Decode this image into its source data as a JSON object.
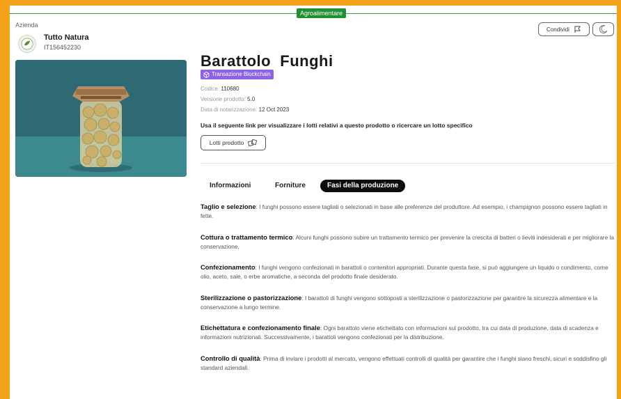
{
  "header": {
    "category_badge": "Agroalimentare",
    "share_label": "Condividi"
  },
  "company": {
    "caption": "Azienda",
    "name": "Tutto Natura",
    "vat": "IT156452230",
    "logo_icon": "leaf-logo"
  },
  "product": {
    "title": "Barattolo  Funghi",
    "blockchain_badge": "Transazione Blockchain",
    "code_label": "Codice:",
    "code_value": "110680",
    "version_label": "Versione prodotto:",
    "version_value": "5.0",
    "notarization_label": "Data di notarizzazione:",
    "notarization_value": "12 Oct 2023",
    "link_text": "Usa il seguente link per visualizzare i lotti relativi a questo prodotto o ricercare un lotto specifico",
    "lots_button": "Lotti prodotto"
  },
  "tabs": [
    {
      "label": "Informazioni",
      "active": false
    },
    {
      "label": "Forniture",
      "active": false
    },
    {
      "label": "Fasi della produzione",
      "active": true
    }
  ],
  "phases": [
    {
      "term": "Taglio e selezione",
      "description": ": I funghi possono essere tagliati o selezionati in base alle preferenze del produttore. Ad esempio, i champignon possono essere tagliati in fette."
    },
    {
      "term": "Cottura o trattamento termico",
      "description": ": Alcuni funghi possono subire un trattamento termico per prevenire la crescita di batteri o lieviti indesiderati e per migliorare la conservazione."
    },
    {
      "term": "Confezionamento",
      "description": ": I funghi vengono confezionati in barattoli o contenitori appropriati. Durante questa fase, si può aggiungere un liquido o condimento, come olio, aceto, sale, o erbe aromatiche, a seconda del prodotto finale desiderato."
    },
    {
      "term": "Sterilizzazione o pastorizzazione",
      "description": ": I barattoli di funghi vengono sottoposti a sterilizzazione o pastorizzazione per garantire la sicurezza alimentare e la conservazione a lungo termine."
    },
    {
      "term": "Etichettatura e confezionamento finale",
      "description": ": Ogni barattolo viene etichettato con informazioni sul prodotto, tra cui data di produzione, data di scadenza e informazioni nutrizionali. Successivamente, i barattoli vengono confezionati per la distribuzione."
    },
    {
      "term": "Controllo di qualità",
      "description": ": Prima di inviare i prodotti al mercato, vengono effettuati controlli di qualità per garantire che i funghi siano freschi, sicuri e soddisfino gli standard aziendali."
    }
  ],
  "colors": {
    "frame": "#f5a21b",
    "category_green": "#1f8f30",
    "blockchain_purple": "#8c63e6",
    "active_tab": "#0d0d0d"
  }
}
